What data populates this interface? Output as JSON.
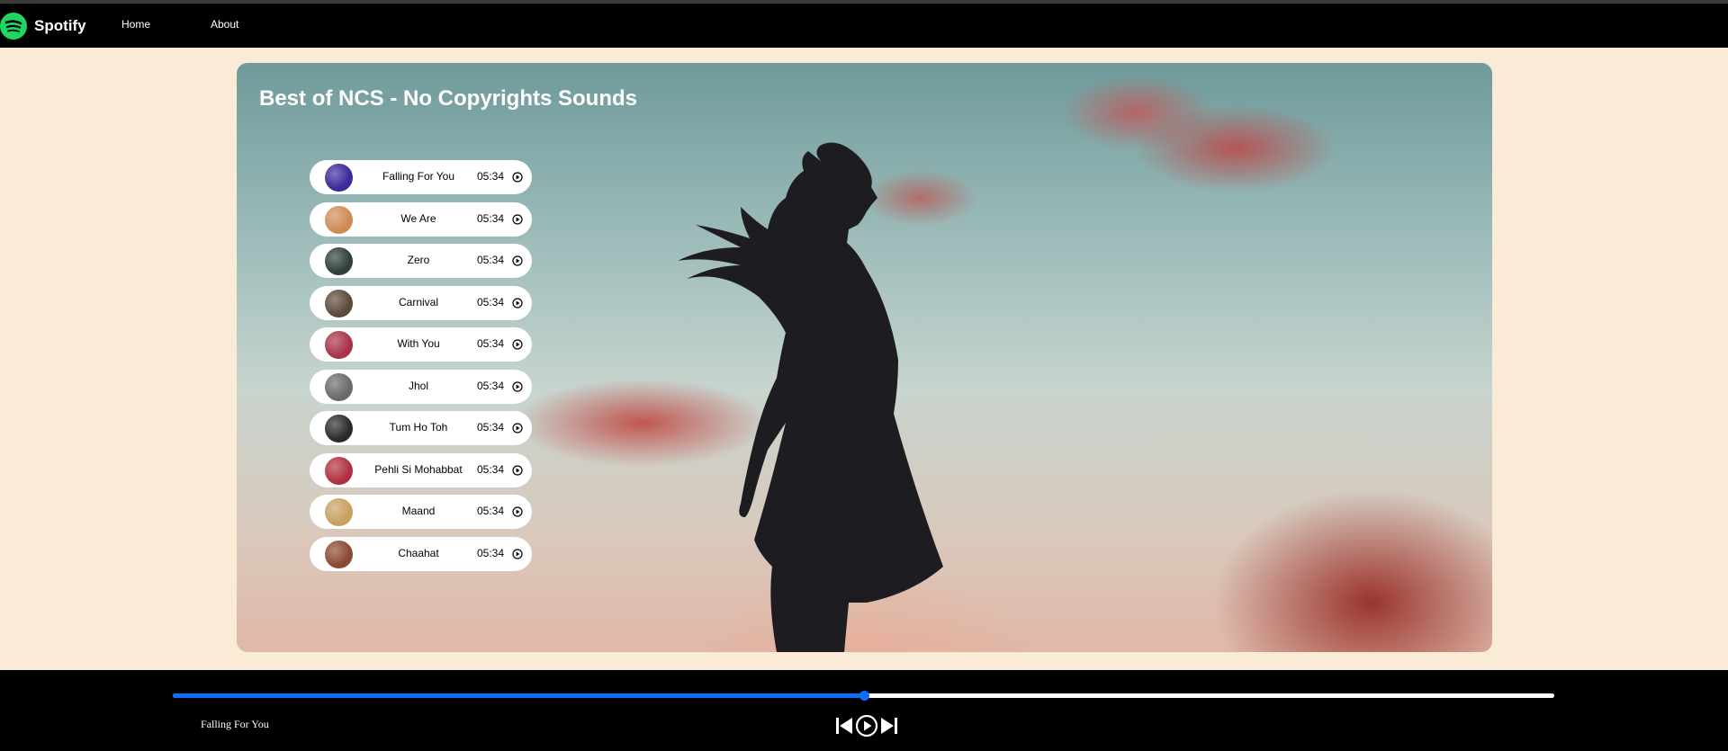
{
  "nav": {
    "brand": "Spotify",
    "links": [
      "Home",
      "About"
    ]
  },
  "playlist": {
    "title": "Best of NCS - No Copyrights Sounds",
    "songs": [
      {
        "name": "Falling For You",
        "duration": "05:34",
        "thumb_color": "#3a2a9a"
      },
      {
        "name": "We Are",
        "duration": "05:34",
        "thumb_color": "#d08a55"
      },
      {
        "name": "Zero",
        "duration": "05:34",
        "thumb_color": "#2f3f3c"
      },
      {
        "name": "Carnival",
        "duration": "05:34",
        "thumb_color": "#5b4a3a"
      },
      {
        "name": "With You",
        "duration": "05:34",
        "thumb_color": "#a8324a"
      },
      {
        "name": "Jhol",
        "duration": "05:34",
        "thumb_color": "#6a6a6a"
      },
      {
        "name": "Tum Ho Toh",
        "duration": "05:34",
        "thumb_color": "#2a2a2a"
      },
      {
        "name": "Pehli Si Mohabbat",
        "duration": "05:34",
        "thumb_color": "#b03040"
      },
      {
        "name": "Maand",
        "duration": "05:34",
        "thumb_color": "#c8a060"
      },
      {
        "name": "Chaahat",
        "duration": "05:34",
        "thumb_color": "#8a4a30"
      }
    ]
  },
  "player": {
    "now_playing": "Falling For You",
    "progress_fraction": 0.5,
    "accent": "#0d6efd"
  }
}
